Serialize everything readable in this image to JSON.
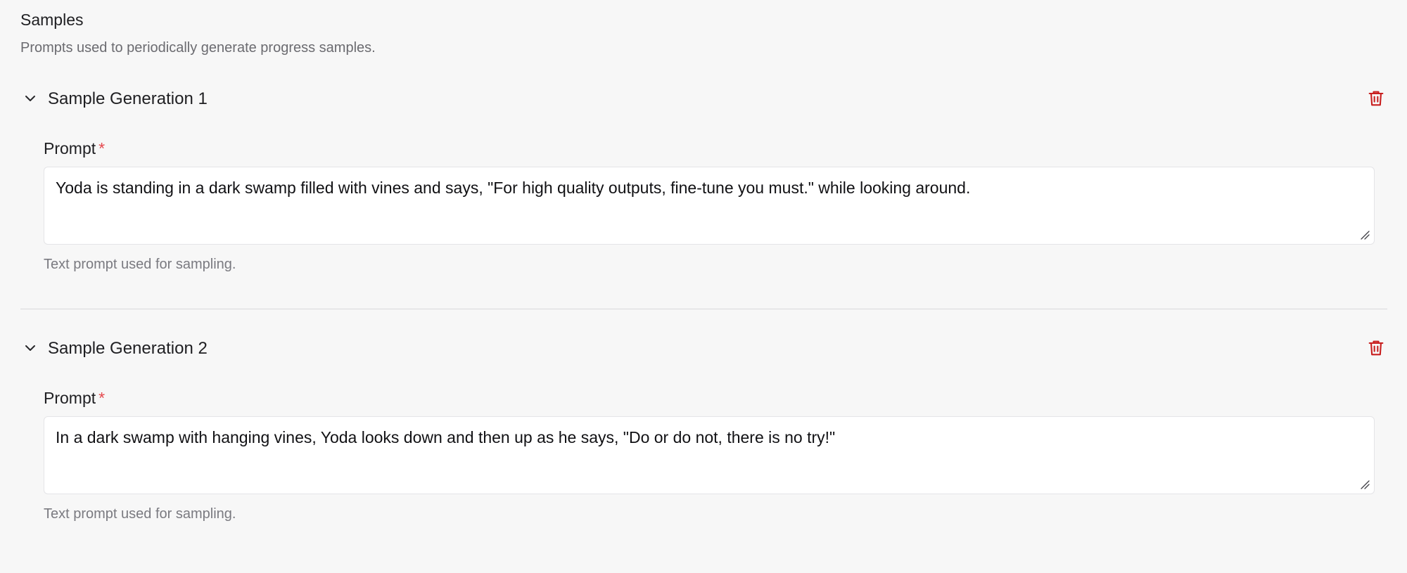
{
  "section": {
    "title": "Samples",
    "description": "Prompts used to periodically generate progress samples."
  },
  "samples": [
    {
      "title": "Sample Generation 1",
      "prompt_label": "Prompt",
      "required_marker": "*",
      "prompt_value": "Yoda is standing in a dark swamp filled with vines and says, \"For high quality outputs, fine-tune you must.\" while looking around.",
      "help_text": "Text prompt used for sampling."
    },
    {
      "title": "Sample Generation 2",
      "prompt_label": "Prompt",
      "required_marker": "*",
      "prompt_value": "In a dark swamp with hanging vines, Yoda looks down and then up as he says, \"Do or do not, there is no try!\"",
      "help_text": "Text prompt used for sampling."
    }
  ],
  "icons": {
    "collapse": "chevron-down-icon",
    "delete": "trash-icon",
    "resize": "resize-handle-icon"
  },
  "colors": {
    "background": "#f7f7f7",
    "delete_red": "#c81e1e",
    "required_red": "#e5484d",
    "muted_text": "#6b6b70"
  }
}
